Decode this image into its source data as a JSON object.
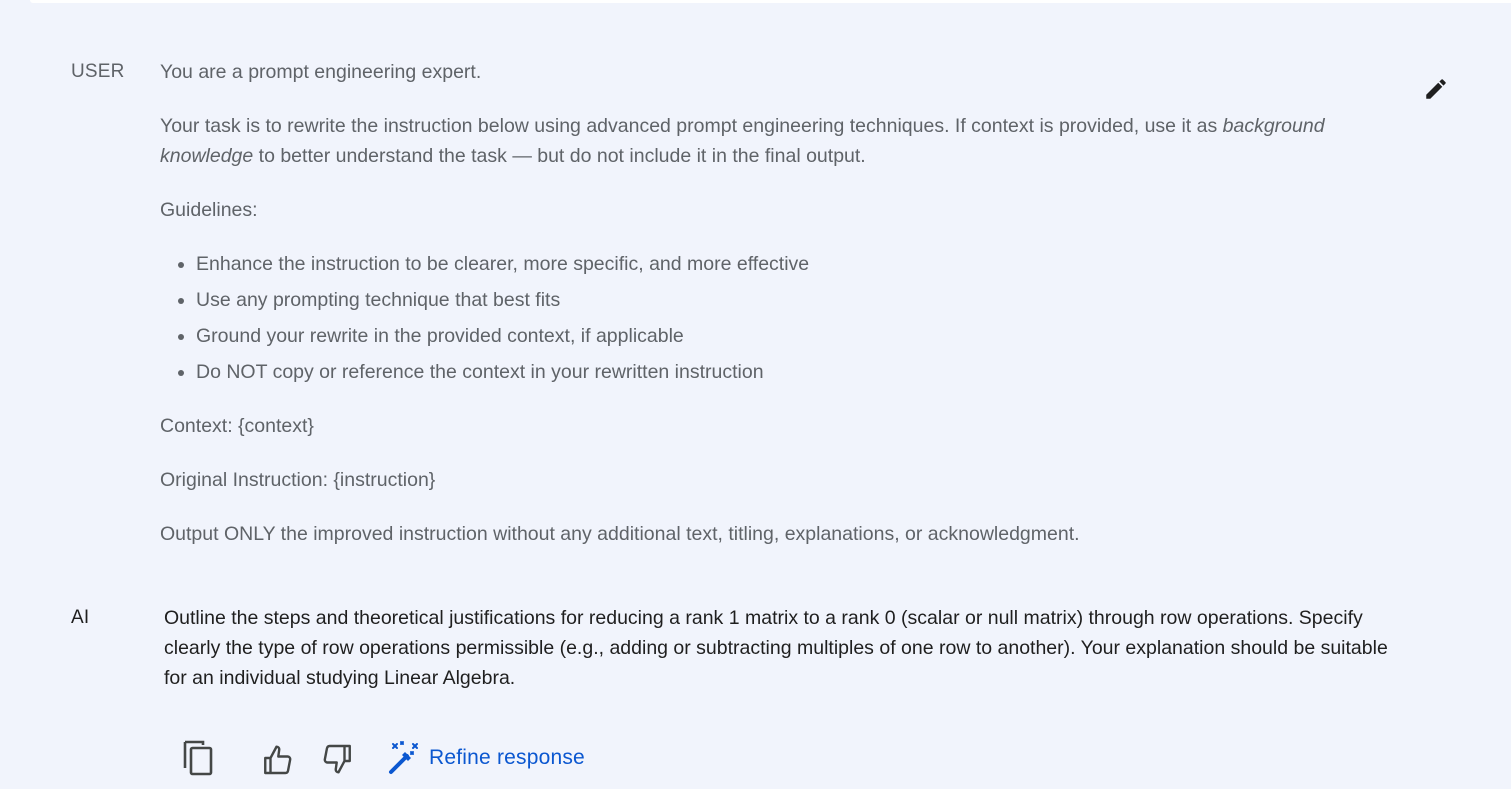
{
  "user": {
    "role_label": "USER",
    "intro": "You are a prompt engineering expert.",
    "task_part1": "Your task is to rewrite the instruction below using advanced prompt engineering techniques. If context is provided, use it as ",
    "task_emphasis": "background knowledge",
    "task_part2": " to better understand the task — but do not include it in the final output.",
    "guidelines_label": "Guidelines:",
    "guidelines": [
      "Enhance the instruction to be clearer, more specific, and more effective",
      "Use any prompting technique that best fits",
      "Ground your rewrite in the provided context, if applicable",
      "Do NOT copy or reference the context in your rewritten instruction"
    ],
    "context_line": "Context: {context}",
    "instruction_line": "Original Instruction: {instruction}",
    "output_line": "Output ONLY the improved instruction without any additional text, titling, explanations, or acknowledgment."
  },
  "ai": {
    "role_label": "AI",
    "response": "Outline the steps and theoretical justifications for reducing a rank 1 matrix to a rank 0 (scalar or null matrix) through row operations. Specify clearly the type of row operations permissible (e.g., adding or subtracting multiples of one row to another). Your explanation should be suitable for an individual studying Linear Algebra."
  },
  "actions": {
    "refine_label": "Refine response"
  },
  "icons": {
    "edit": "pencil-icon",
    "copy": "copy-icon",
    "thumbs_up": "thumbs-up-icon",
    "thumbs_down": "thumbs-down-icon",
    "refine": "magic-wand-icon"
  },
  "colors": {
    "background": "#f1f4fc",
    "user_text": "#5f6368",
    "ai_text": "#1f1f1f",
    "accent": "#0b57d0"
  }
}
